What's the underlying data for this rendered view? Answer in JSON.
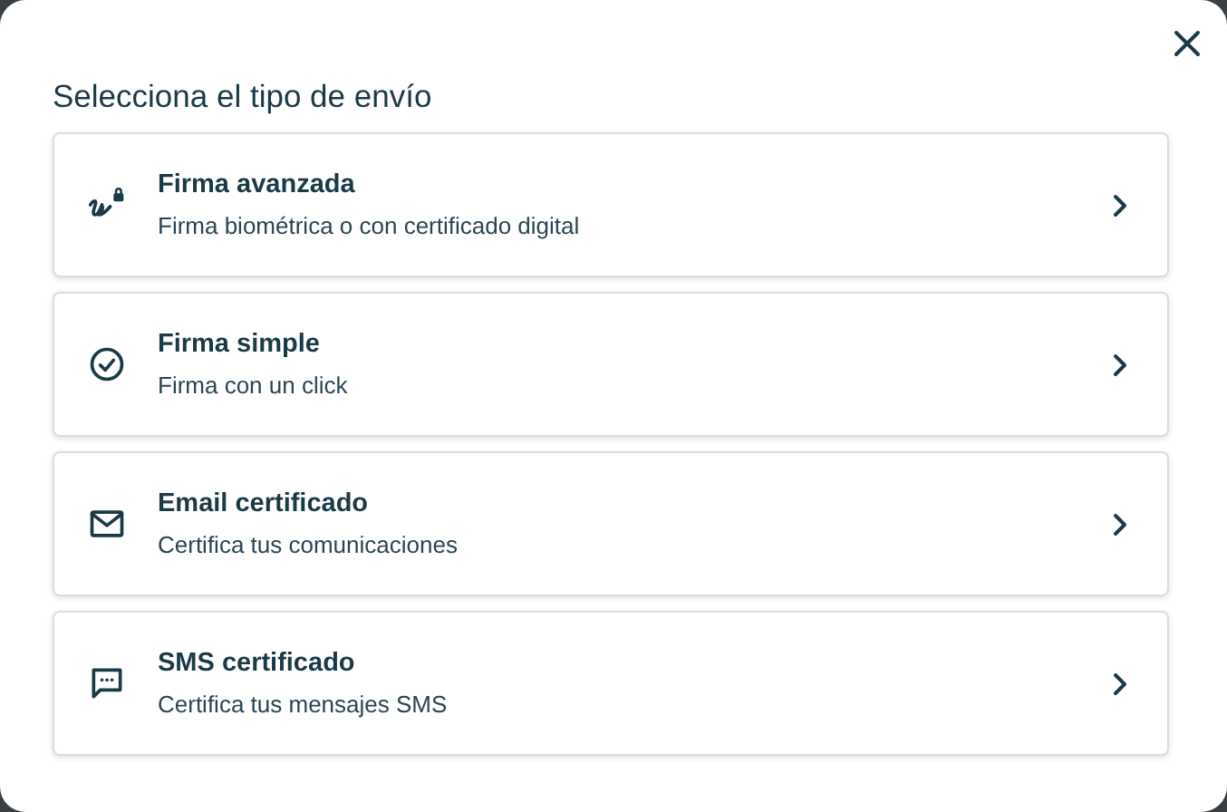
{
  "dialog": {
    "title": "Selecciona el tipo de envío"
  },
  "options": [
    {
      "kind": "signature",
      "title": "Firma avanzada",
      "description": "Firma biométrica o con certificado digital"
    },
    {
      "kind": "check",
      "title": "Firma simple",
      "description": "Firma con un click"
    },
    {
      "kind": "email",
      "title": "Email certificado",
      "description": "Certifica tus comunicaciones"
    },
    {
      "kind": "sms",
      "title": "SMS certificado",
      "description": "Certifica tus mensajes SMS"
    }
  ]
}
